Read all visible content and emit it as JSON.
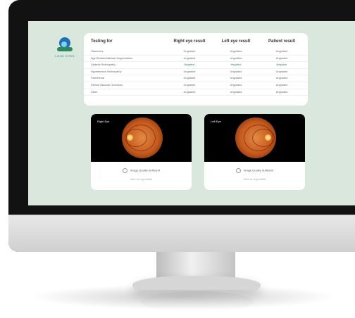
{
  "logo": {
    "text": "LOOK EYES"
  },
  "results": {
    "headers": [
      "Testing for",
      "Right eye result",
      "Left eye result",
      "Patient result"
    ],
    "rows": [
      {
        "test": "Glaucoma",
        "right": "Ungraded",
        "left": "Ungraded",
        "patient": "Ungraded"
      },
      {
        "test": "Age Related Macular Degeneration",
        "right": "Ungraded",
        "left": "Ungraded",
        "patient": "Ungraded"
      },
      {
        "test": "Diabetic Retinopathy",
        "right": "Negative",
        "left": "Negative",
        "patient": "Negative"
      },
      {
        "test": "Hypertensive Retinopathy",
        "right": "Ungraded",
        "left": "Ungraded",
        "patient": "Ungraded"
      },
      {
        "test": "Pachinema",
        "right": "Ungraded",
        "left": "Ungraded",
        "patient": "Ungraded"
      },
      {
        "test": "Retinal Vascular Occlusion",
        "right": "Ungraded",
        "left": "Ungraded",
        "patient": "Ungraded"
      },
      {
        "test": "Other",
        "right": "Ungraded",
        "left": "Ungraded",
        "patient": "Ungraded"
      }
    ],
    "colors": {
      "negative": "#2c8a5a",
      "card": "#ffffff",
      "screen_bg": "#dae7dc"
    }
  },
  "right_eye": {
    "title": "Right Eye",
    "quality_label": "Image Quality Sufficient",
    "mark_label": "Mark as ungradable"
  },
  "left_eye": {
    "title": "Left Eye",
    "quality_label": "Image Quality Sufficient",
    "mark_label": "Mark as ungradable"
  }
}
